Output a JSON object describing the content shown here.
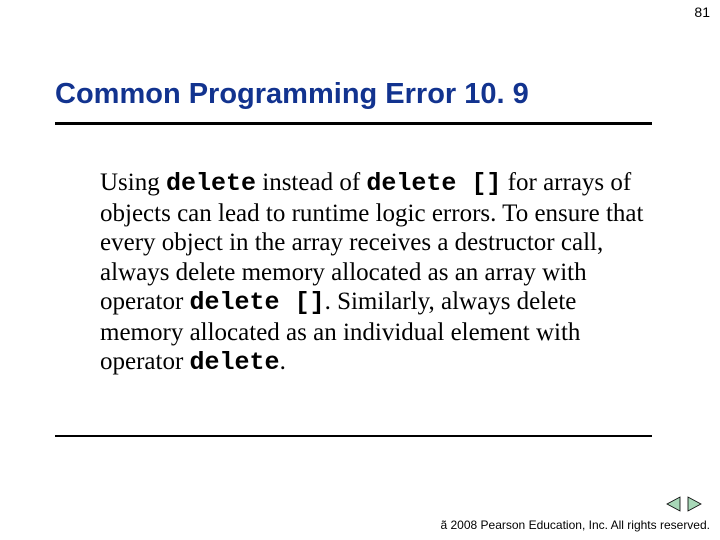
{
  "page_number": "81",
  "heading": "Common Programming Error 10. 9",
  "body": {
    "t1": "Using ",
    "c1": "delete",
    "t2": " instead of ",
    "c2": "delete []",
    "t3": " for arrays of objects can lead to runtime logic errors. To ensure that every object in the array receives a destructor call, always delete memory allocated as an array with operator ",
    "c3": "delete []",
    "t4": ". Similarly, always delete memory allocated as an individual element with operator ",
    "c4": "delete",
    "t5": "."
  },
  "copyright": "ã 2008 Pearson Education, Inc.  All rights reserved."
}
